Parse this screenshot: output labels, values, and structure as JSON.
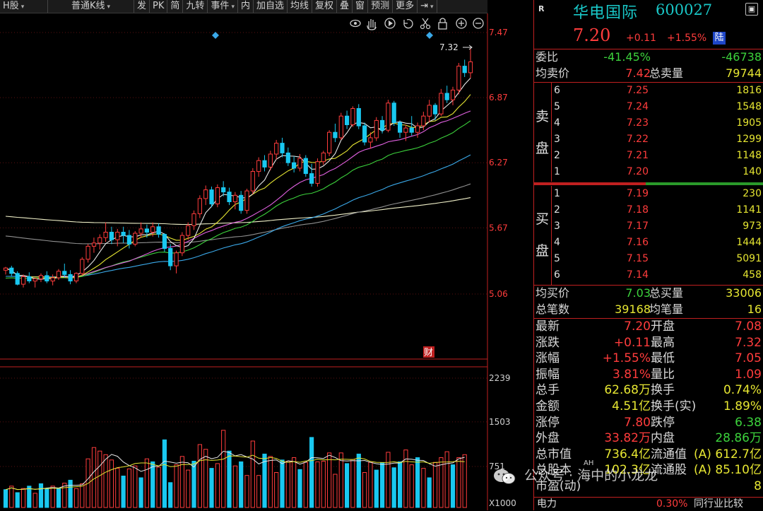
{
  "toolbar": {
    "items": [
      {
        "label": "H股",
        "dropdown": true
      },
      {
        "label": "普通K线",
        "dropdown": true
      },
      {
        "label": "发",
        "dropdown": false
      },
      {
        "label": "PK",
        "dropdown": false
      },
      {
        "label": "简",
        "dropdown": false
      },
      {
        "label": "九转",
        "dropdown": false
      },
      {
        "label": "事件",
        "dropdown": true
      },
      {
        "label": "内",
        "dropdown": false
      },
      {
        "label": "加自选",
        "dropdown": false
      },
      {
        "label": "均线",
        "dropdown": false
      },
      {
        "label": "复权",
        "dropdown": false
      },
      {
        "label": "叠",
        "dropdown": false
      },
      {
        "label": "窗",
        "dropdown": false
      },
      {
        "label": "预测",
        "dropdown": false
      },
      {
        "label": "更多",
        "dropdown": false
      },
      {
        "label": "⇥",
        "dropdown": true
      }
    ],
    "chart_tools": [
      "eye-icon",
      "hand-icon",
      "play-icon",
      "undo-icon",
      "scissors-icon",
      "lock-icon",
      "zoom-in-icon",
      "zoom-out-icon"
    ]
  },
  "chart_data": {
    "type": "candlestick",
    "price_axis_labels": [
      "7.47",
      "6.87",
      "6.27",
      "5.67",
      "5.06"
    ],
    "price_axis_values": [
      7.47,
      6.87,
      6.27,
      5.67,
      5.06
    ],
    "high_marker": "7.32",
    "event_marker": "财",
    "volume_axis_labels": [
      "2239",
      "1503",
      "751"
    ],
    "volume_axis_values": [
      2239,
      1503,
      751
    ],
    "volume_unit": "X1000",
    "colors": {
      "up": "#ff3c3c",
      "down": "#19c8f0",
      "ma5": "#e8e8e8",
      "ma10": "#e6e632",
      "ma20": "#e060e0",
      "ma30": "#3cd23c",
      "ma60": "#3aa8e8",
      "ma120": "#909090",
      "ma250": "#f0f0c8"
    },
    "candles": [
      [
        5.28,
        5.31,
        5.24,
        5.3
      ],
      [
        5.3,
        5.32,
        5.22,
        5.25
      ],
      [
        5.25,
        5.27,
        5.14,
        5.15
      ],
      [
        5.15,
        5.24,
        5.12,
        5.22
      ],
      [
        5.22,
        5.26,
        5.16,
        5.18
      ],
      [
        5.18,
        5.21,
        5.12,
        5.2
      ],
      [
        5.2,
        5.25,
        5.17,
        5.23
      ],
      [
        5.23,
        5.27,
        5.16,
        5.18
      ],
      [
        5.18,
        5.24,
        5.14,
        5.21
      ],
      [
        5.21,
        5.29,
        5.19,
        5.27
      ],
      [
        5.27,
        5.34,
        5.21,
        5.24
      ],
      [
        5.24,
        5.28,
        5.15,
        5.18
      ],
      [
        5.18,
        5.26,
        5.16,
        5.25
      ],
      [
        5.25,
        5.4,
        5.23,
        5.38
      ],
      [
        5.38,
        5.52,
        5.35,
        5.5
      ],
      [
        5.5,
        5.58,
        5.44,
        5.53
      ],
      [
        5.53,
        5.61,
        5.47,
        5.58
      ],
      [
        5.58,
        5.72,
        5.54,
        5.63
      ],
      [
        5.63,
        5.68,
        5.52,
        5.56
      ],
      [
        5.56,
        5.66,
        5.5,
        5.63
      ],
      [
        5.63,
        5.68,
        5.53,
        5.6
      ],
      [
        5.6,
        5.65,
        5.48,
        5.52
      ],
      [
        5.52,
        5.64,
        5.5,
        5.62
      ],
      [
        5.62,
        5.72,
        5.58,
        5.66
      ],
      [
        5.66,
        5.7,
        5.58,
        5.63
      ],
      [
        5.63,
        5.72,
        5.59,
        5.68
      ],
      [
        5.68,
        5.71,
        5.58,
        5.61
      ],
      [
        5.61,
        5.62,
        5.45,
        5.48
      ],
      [
        5.48,
        5.52,
        5.28,
        5.32
      ],
      [
        5.32,
        5.46,
        5.25,
        5.44
      ],
      [
        5.44,
        5.63,
        5.41,
        5.6
      ],
      [
        5.6,
        5.72,
        5.56,
        5.69
      ],
      [
        5.69,
        5.83,
        5.65,
        5.8
      ],
      [
        5.8,
        5.97,
        5.76,
        5.94
      ],
      [
        5.94,
        6.06,
        5.88,
        6.02
      ],
      [
        6.02,
        6.05,
        5.86,
        5.89
      ],
      [
        5.89,
        6.07,
        5.86,
        6.04
      ],
      [
        6.04,
        6.1,
        5.96,
        6.0
      ],
      [
        6.0,
        6.04,
        5.88,
        5.91
      ],
      [
        5.91,
        6.0,
        5.84,
        5.97
      ],
      [
        5.97,
        6.01,
        5.8,
        5.83
      ],
      [
        5.83,
        6.03,
        5.8,
        6.01
      ],
      [
        6.01,
        6.22,
        5.98,
        6.19
      ],
      [
        6.19,
        6.32,
        6.14,
        6.29
      ],
      [
        6.29,
        6.34,
        6.19,
        6.23
      ],
      [
        6.23,
        6.38,
        6.2,
        6.35
      ],
      [
        6.35,
        6.48,
        6.3,
        6.45
      ],
      [
        6.45,
        6.5,
        6.32,
        6.36
      ],
      [
        6.36,
        6.41,
        6.24,
        6.27
      ],
      [
        6.27,
        6.33,
        6.18,
        6.22
      ],
      [
        6.22,
        6.35,
        6.19,
        6.31
      ],
      [
        6.31,
        6.34,
        6.14,
        6.17
      ],
      [
        6.17,
        6.26,
        6.05,
        6.08
      ],
      [
        6.08,
        6.31,
        6.05,
        6.28
      ],
      [
        6.28,
        6.38,
        6.25,
        6.36
      ],
      [
        6.36,
        6.57,
        6.33,
        6.55
      ],
      [
        6.55,
        6.63,
        6.46,
        6.5
      ],
      [
        6.5,
        6.73,
        6.48,
        6.7
      ],
      [
        6.7,
        6.75,
        6.58,
        6.62
      ],
      [
        6.62,
        6.79,
        6.6,
        6.77
      ],
      [
        6.77,
        6.81,
        6.58,
        6.61
      ],
      [
        6.61,
        6.64,
        6.43,
        6.46
      ],
      [
        6.46,
        6.55,
        6.4,
        6.5
      ],
      [
        6.5,
        6.69,
        6.47,
        6.66
      ],
      [
        6.66,
        6.7,
        6.54,
        6.57
      ],
      [
        6.57,
        6.85,
        6.55,
        6.82
      ],
      [
        6.82,
        6.84,
        6.61,
        6.64
      ],
      [
        6.64,
        6.66,
        6.5,
        6.55
      ],
      [
        6.55,
        6.62,
        6.47,
        6.59
      ],
      [
        6.59,
        6.7,
        6.52,
        6.55
      ],
      [
        6.55,
        6.64,
        6.5,
        6.61
      ],
      [
        6.61,
        6.74,
        6.57,
        6.7
      ],
      [
        6.7,
        6.85,
        6.64,
        6.8
      ],
      [
        6.8,
        6.82,
        6.66,
        6.72
      ],
      [
        6.72,
        6.95,
        6.7,
        6.91
      ],
      [
        6.91,
        6.98,
        6.82,
        6.85
      ],
      [
        6.85,
        6.97,
        6.8,
        6.94
      ],
      [
        6.94,
        7.19,
        6.9,
        7.16
      ],
      [
        7.16,
        7.22,
        7.06,
        7.1
      ],
      [
        7.1,
        7.32,
        7.05,
        7.2
      ]
    ],
    "volumes": [
      [
        360,
        "d"
      ],
      [
        420,
        "u"
      ],
      [
        310,
        "d"
      ],
      [
        380,
        "u"
      ],
      [
        420,
        "d"
      ],
      [
        300,
        "u"
      ],
      [
        460,
        "d"
      ],
      [
        380,
        "d"
      ],
      [
        420,
        "u"
      ],
      [
        380,
        "d"
      ],
      [
        470,
        "u"
      ],
      [
        520,
        "d"
      ],
      [
        380,
        "u"
      ],
      [
        460,
        "u"
      ],
      [
        880,
        "u"
      ],
      [
        1070,
        "u"
      ],
      [
        1010,
        "u"
      ],
      [
        950,
        "u"
      ],
      [
        860,
        "u"
      ],
      [
        720,
        "u"
      ],
      [
        590,
        "d"
      ],
      [
        710,
        "u"
      ],
      [
        760,
        "u"
      ],
      [
        560,
        "d"
      ],
      [
        880,
        "u"
      ],
      [
        830,
        "d"
      ],
      [
        740,
        "u"
      ],
      [
        1200,
        "d"
      ],
      [
        480,
        "d"
      ],
      [
        780,
        "u"
      ],
      [
        920,
        "u"
      ],
      [
        690,
        "u"
      ],
      [
        840,
        "d"
      ],
      [
        1120,
        "u"
      ],
      [
        1040,
        "u"
      ],
      [
        720,
        "d"
      ],
      [
        800,
        "u"
      ],
      [
        1360,
        "u"
      ],
      [
        1010,
        "d"
      ],
      [
        760,
        "u"
      ],
      [
        830,
        "d"
      ],
      [
        600,
        "u"
      ],
      [
        1180,
        "u"
      ],
      [
        600,
        "u"
      ],
      [
        960,
        "d"
      ],
      [
        920,
        "u"
      ],
      [
        650,
        "u"
      ],
      [
        860,
        "d"
      ],
      [
        840,
        "u"
      ],
      [
        900,
        "u"
      ],
      [
        700,
        "d"
      ],
      [
        820,
        "u"
      ],
      [
        1240,
        "d"
      ],
      [
        830,
        "u"
      ],
      [
        840,
        "u"
      ],
      [
        980,
        "u"
      ],
      [
        620,
        "u"
      ],
      [
        980,
        "u"
      ],
      [
        800,
        "d"
      ],
      [
        870,
        "u"
      ],
      [
        960,
        "d"
      ],
      [
        650,
        "u"
      ],
      [
        820,
        "u"
      ],
      [
        690,
        "d"
      ],
      [
        810,
        "d"
      ],
      [
        990,
        "u"
      ],
      [
        730,
        "d"
      ],
      [
        830,
        "d"
      ],
      [
        1030,
        "u"
      ],
      [
        780,
        "u"
      ],
      [
        900,
        "d"
      ],
      [
        720,
        "u"
      ],
      [
        560,
        "d"
      ],
      [
        820,
        "u"
      ],
      [
        900,
        "u"
      ],
      [
        1000,
        "u"
      ],
      [
        780,
        "d"
      ],
      [
        900,
        "u"
      ],
      [
        950,
        "u"
      ]
    ]
  },
  "quote": {
    "r_label": "R",
    "name": "华电国际",
    "code": "600027",
    "menu": "▣",
    "price": "7.20",
    "change": "+0.11",
    "change_pct": "+1.55%",
    "market_badge": "陆",
    "weibi_label": "委比",
    "weibi_pct": "-41.45%",
    "weibi_val": "-46738",
    "avg_sell_label": "均卖价",
    "avg_sell": "7.42",
    "total_sell_label": "总卖量",
    "total_sell": "79744",
    "sell_side_label_1": "卖",
    "sell_side_label_2": "盘",
    "buy_side_label_1": "买",
    "buy_side_label_2": "盘",
    "asks": [
      {
        "lvl": "6",
        "px": "7.25",
        "vol": "1816"
      },
      {
        "lvl": "5",
        "px": "7.24",
        "vol": "1548"
      },
      {
        "lvl": "4",
        "px": "7.23",
        "vol": "1905"
      },
      {
        "lvl": "3",
        "px": "7.22",
        "vol": "1299"
      },
      {
        "lvl": "2",
        "px": "7.21",
        "vol": "1148"
      },
      {
        "lvl": "1",
        "px": "7.20",
        "vol": "140"
      }
    ],
    "bids": [
      {
        "lvl": "1",
        "px": "7.19",
        "vol": "230"
      },
      {
        "lvl": "2",
        "px": "7.18",
        "vol": "1141"
      },
      {
        "lvl": "3",
        "px": "7.17",
        "vol": "973"
      },
      {
        "lvl": "4",
        "px": "7.16",
        "vol": "1444"
      },
      {
        "lvl": "5",
        "px": "7.15",
        "vol": "5091"
      },
      {
        "lvl": "6",
        "px": "7.14",
        "vol": "458"
      }
    ],
    "avg_buy_label": "均买价",
    "avg_buy": "7.03",
    "total_buy_label": "总买量",
    "total_buy": "33006",
    "trades_label": "总笔数",
    "trades": "39168",
    "avg_trade_label": "均笔量",
    "avg_trade": "16",
    "stats": [
      {
        "l1": "最新",
        "v1": "7.20",
        "c1": "red",
        "l2": "开盘",
        "v2": "7.08",
        "c2": "red"
      },
      {
        "l1": "涨跌",
        "v1": "+0.11",
        "c1": "red",
        "l2": "最高",
        "v2": "7.32",
        "c2": "red"
      },
      {
        "l1": "涨幅",
        "v1": "+1.55%",
        "c1": "red",
        "l2": "最低",
        "v2": "7.05",
        "c2": "red"
      },
      {
        "l1": "振幅",
        "v1": "3.81%",
        "c1": "red",
        "l2": "量比",
        "v2": "1.09",
        "c2": "red"
      },
      {
        "l1": "总手",
        "v1": "62.68万",
        "c1": "yellow",
        "l2": "换手",
        "v2": "0.74%",
        "c2": "yellow"
      },
      {
        "l1": "金额",
        "v1": "4.51亿",
        "c1": "yellow",
        "l2": "换手(实)",
        "v2": "1.89%",
        "c2": "yellow"
      },
      {
        "l1": "涨停",
        "v1": "7.80",
        "c1": "red",
        "l2": "跌停",
        "v2": "6.38",
        "c2": "green"
      },
      {
        "l1": "外盘",
        "v1": "33.82万",
        "c1": "red",
        "l2": "内盘",
        "v2": "28.86万",
        "c2": "green"
      },
      {
        "l1": "总市值",
        "v1": "736.4亿",
        "c1": "yellow",
        "l2": "流通值",
        "v2": "(A) 612.7亿",
        "c2": "yellow"
      },
      {
        "l1": "总股本",
        "v1": "102.3亿",
        "c1": "yellow",
        "l2": "流通股",
        "v2": "(A) 85.10亿",
        "c2": "yellow"
      },
      {
        "l1": "市盈(动)",
        "v1": "",
        "c1": "yellow",
        "l2": "",
        "v2": "8",
        "c2": "yellow"
      }
    ],
    "ah_tag": "AH",
    "bottom_label": "电力",
    "bottom_pct": "0.30%",
    "bottom_link": "同行业比较"
  },
  "watermark": "公众号 · 海中的小龙龙"
}
